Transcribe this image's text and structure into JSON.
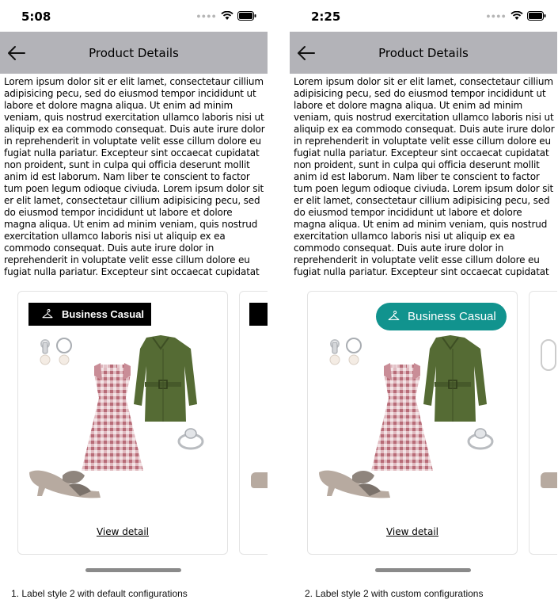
{
  "screens": [
    {
      "time": "5:08",
      "nav_title": "Product Details",
      "description": "Lorem ipsum dolor sit er elit lamet, consectetaur cillium adipisicing pecu, sed do eiusmod tempor incididunt ut labore et dolore magna aliqua. Ut enim ad minim veniam, quis nostrud exercitation ullamco laboris nisi ut aliquip ex ea commodo consequat. Duis aute irure dolor in reprehenderit in voluptate velit esse cillum dolore eu fugiat nulla pariatur. Excepteur sint occaecat cupidatat non proident, sunt in culpa qui officia deserunt mollit anim id est laborum. Nam liber te conscient to factor tum poen legum odioque civiuda. Lorem ipsum dolor sit er elit lamet, consectetaur cillium adipisicing pecu, sed do eiusmod tempor incididunt ut labore et dolore magna aliqua. Ut enim ad minim veniam, quis nostrud exercitation ullamco laboris nisi ut aliquip ex ea commodo consequat. Duis aute irure dolor in reprehenderit in voluptate velit esse cillum dolore eu fugiat nulla pariatur. Excepteur sint occaecat cupidatat",
      "label": "Business Casual",
      "view_detail": "View detail",
      "caption": "1. Label style 2 with default configurations"
    },
    {
      "time": "2:25",
      "nav_title": "Product Details",
      "description": "Lorem ipsum dolor sit er elit lamet, consectetaur cillium adipisicing pecu, sed do eiusmod tempor incididunt ut labore et dolore magna aliqua. Ut enim ad minim veniam, quis nostrud exercitation ullamco laboris nisi ut aliquip ex ea commodo consequat. Duis aute irure dolor in reprehenderit in voluptate velit esse cillum dolore eu fugiat nulla pariatur. Excepteur sint occaecat cupidatat non proident, sunt in culpa qui officia deserunt mollit anim id est laborum. Nam liber te conscient to factor tum poen legum odioque civiuda. Lorem ipsum dolor sit er elit lamet, consectetaur cillium adipisicing pecu, sed do eiusmod tempor incididunt ut labore et dolore magna aliqua. Ut enim ad minim veniam, quis nostrud exercitation ullamco laboris nisi ut aliquip ex ea commodo consequat. Duis aute irure dolor in reprehenderit in voluptate velit esse cillum dolore eu fugiat nulla pariatur. Excepteur sint occaecat cupidatat",
      "label": "Business Casual",
      "view_detail": "View detail",
      "caption": "2. Label style 2 with custom configurations"
    }
  ],
  "icons": {
    "back": "back-arrow-icon",
    "label": "hanger-icon",
    "status": [
      "cellular-signal-icon",
      "wifi-icon",
      "battery-icon"
    ]
  },
  "colors": {
    "nav_bar": "#b3b3b8",
    "label_default_bg": "#000000",
    "label_custom_bg": "#11938e"
  }
}
